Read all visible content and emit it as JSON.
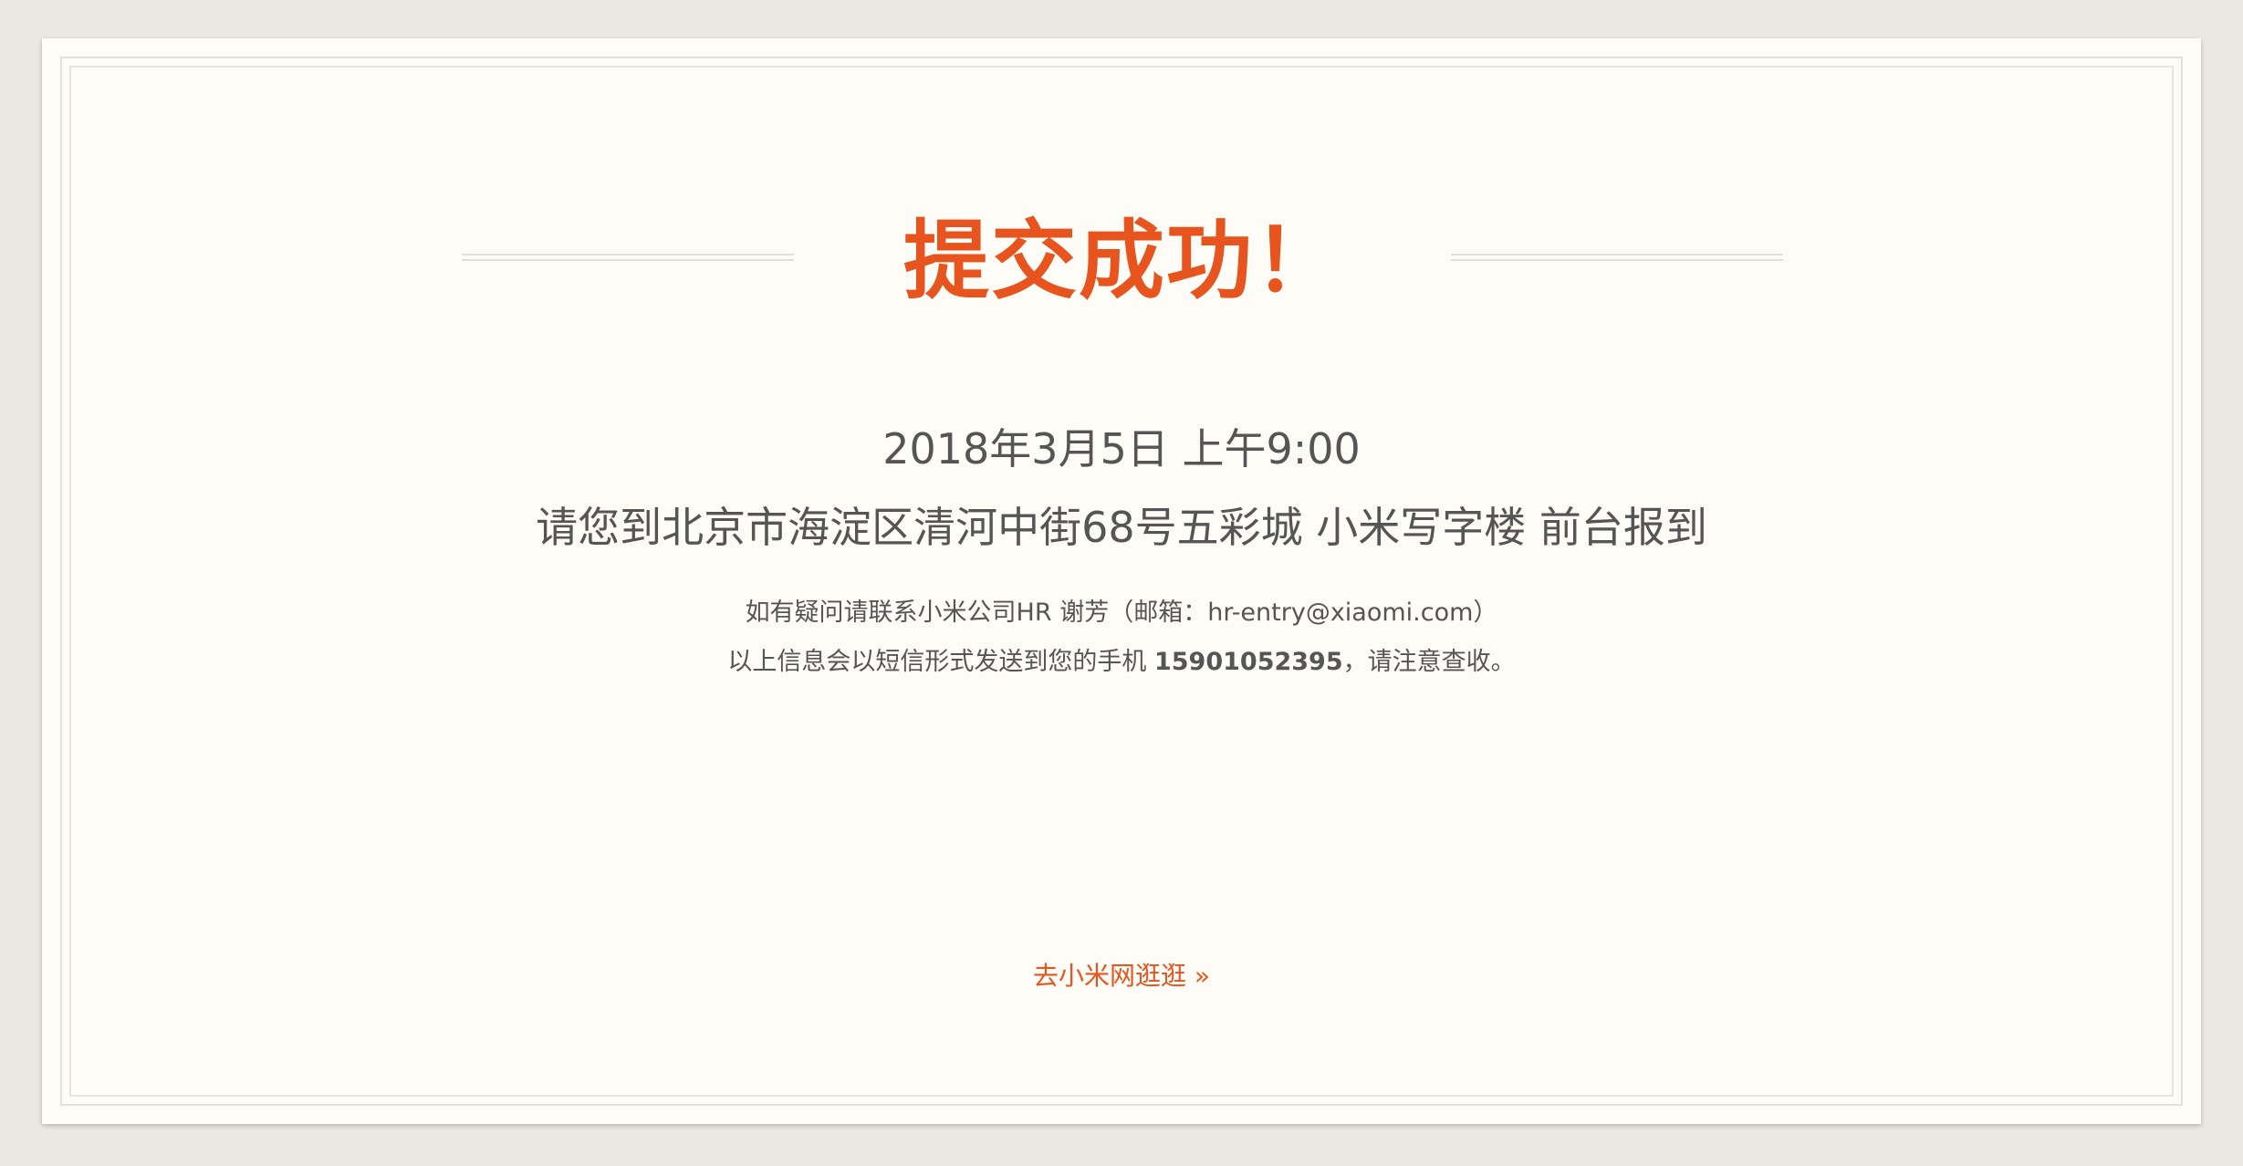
{
  "title": "提交成功！",
  "datetime": "2018年3月5日 上午9:00",
  "address": "请您到北京市海淀区清河中街68号五彩城 小米写字楼 前台报到",
  "contact": "如有疑问请联系小米公司HR 谢芳（邮箱：hr-entry@xiaomi.com）",
  "sms": {
    "prefix": "以上信息会以短信形式发送到您的手机 ",
    "phone": "15901052395",
    "suffix": "，请注意查收。"
  },
  "link_label": "去小米网逛逛 »",
  "colors": {
    "accent": "#e8541e",
    "text": "#555555",
    "card_bg": "#fdfcf7",
    "page_bg": "#ebe8e1"
  }
}
